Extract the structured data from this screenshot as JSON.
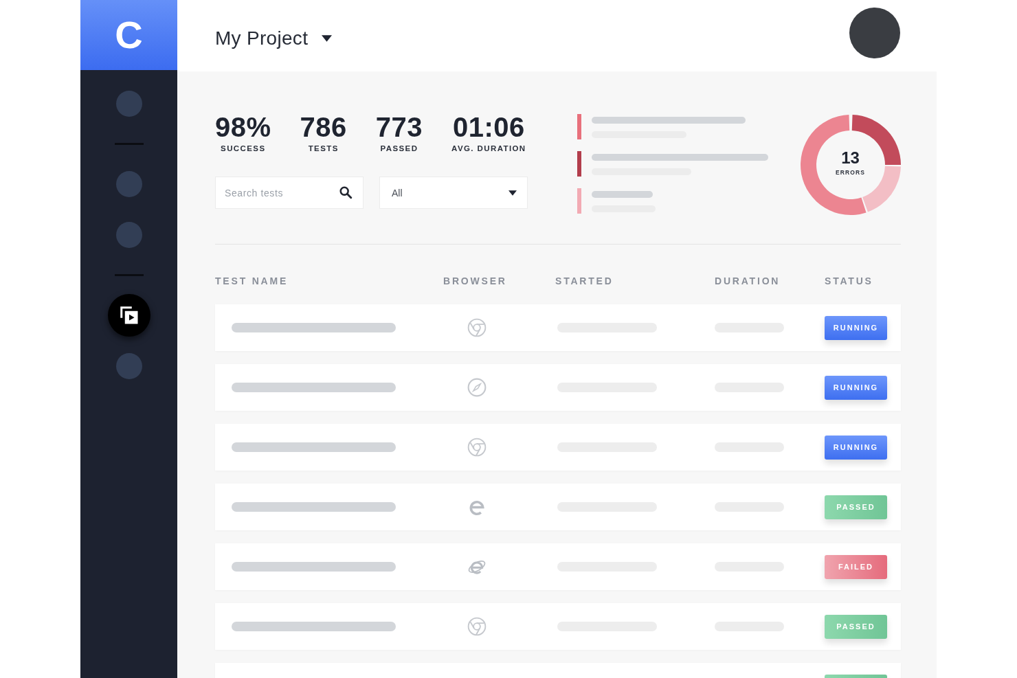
{
  "sidebar": {
    "logo": "C",
    "groups": [
      {
        "items": [
          {
            "selected": false
          }
        ]
      },
      {
        "items": [
          {
            "selected": false
          },
          {
            "selected": false
          }
        ]
      },
      {
        "items": [
          {
            "selected": true
          },
          {
            "selected": false
          }
        ]
      }
    ]
  },
  "header": {
    "project": "My Project"
  },
  "stats": [
    {
      "value": "98%",
      "label": "SUCCESS"
    },
    {
      "value": "786",
      "label": "TESTS"
    },
    {
      "value": "773",
      "label": "PASSED"
    },
    {
      "value": "01:06",
      "label": "AVG. DURATION"
    }
  ],
  "search": {
    "placeholder": "Search tests"
  },
  "filter": {
    "value": "All"
  },
  "error_legend": [
    {
      "color": "#e8707c"
    },
    {
      "color": "#b23e4c"
    },
    {
      "color": "#f2aab3"
    }
  ],
  "errors_donut": {
    "value": "13",
    "label": "ERRORS",
    "slices": [
      {
        "color": "#c24b5b"
      },
      {
        "color": "#f3bec5"
      },
      {
        "color": "#ec8591"
      }
    ]
  },
  "table": {
    "columns": [
      "TEST NAME",
      "BROWSER",
      "STARTED",
      "DURATION",
      "STATUS"
    ],
    "rows": [
      {
        "browser": {
          "kind": "ring"
        },
        "status": {
          "kind": "running",
          "label": "RUNNING"
        }
      },
      {
        "browser": {
          "kind": "compass"
        },
        "status": {
          "kind": "running",
          "label": "RUNNING"
        }
      },
      {
        "browser": {
          "kind": "ring"
        },
        "status": {
          "kind": "running",
          "label": "RUNNING"
        }
      },
      {
        "browser": {
          "kind": "swirl"
        },
        "status": {
          "kind": "passed",
          "label": "PASSED"
        }
      },
      {
        "browser": {
          "kind": "orbit"
        },
        "status": {
          "kind": "failed",
          "label": "FAILED"
        }
      },
      {
        "browser": {
          "kind": "ring"
        },
        "status": {
          "kind": "passed",
          "label": "PASSED"
        }
      },
      {
        "status": {
          "kind": "passed"
        }
      }
    ]
  }
}
